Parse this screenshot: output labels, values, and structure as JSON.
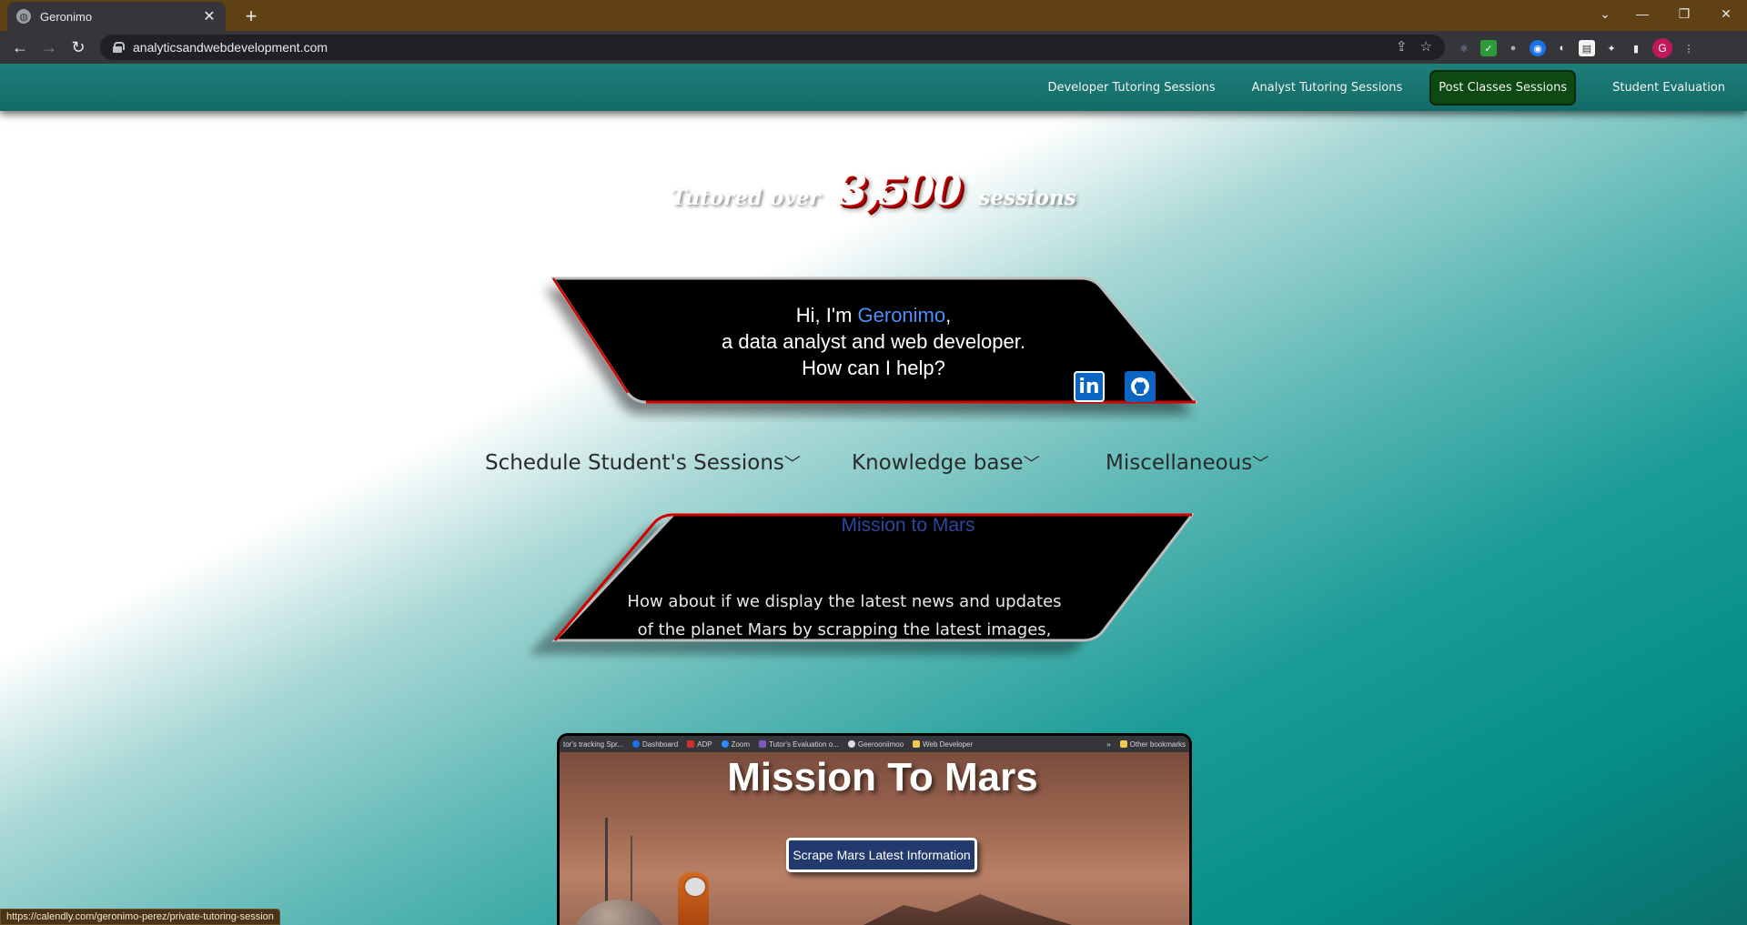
{
  "browser": {
    "tab_title": "Geronimo",
    "url": "analyticsandwebdevelopment.com",
    "status_url": "https://calendly.com/geronimo-perez/private-tutoring-session",
    "profile_initial": "G",
    "accent": "#5f4114"
  },
  "nav": {
    "links": [
      {
        "label": "Developer Tutoring Sessions",
        "active": false
      },
      {
        "label": "Analyst Tutoring Sessions",
        "active": false
      },
      {
        "label": "Post Classes Sessions",
        "active": true
      },
      {
        "label": "Student Evaluation",
        "active": false
      }
    ]
  },
  "hero": {
    "prefix": "Tutored over",
    "count": "3,500",
    "suffix": "sessions"
  },
  "intro": {
    "greeting": "Hi, I'm",
    "name": "Geronimo",
    "comma": ",",
    "line2": "a data analyst and web developer.",
    "line3": "How can I help?",
    "social": [
      "linkedin-icon",
      "github-icon"
    ]
  },
  "menus": [
    {
      "label": "Schedule Student's Sessions"
    },
    {
      "label": "Knowledge base"
    },
    {
      "label": "Miscellaneous"
    }
  ],
  "project": {
    "title": "Mission to Mars",
    "line1": "How about if we display the latest news and updates",
    "line2": "of the planet Mars by scrapping the latest images,"
  },
  "preview": {
    "bookmarks": [
      "tor's tracking Spr...",
      "Dashboard",
      "ADP",
      "Zoom",
      "Tutor's Evaluation o...",
      "Geerooniimoo",
      "Web Developer"
    ],
    "more": "»",
    "other_bookmarks": "Other bookmarks",
    "title": "Mission To Mars",
    "button": "Scrape Mars Latest Information"
  }
}
